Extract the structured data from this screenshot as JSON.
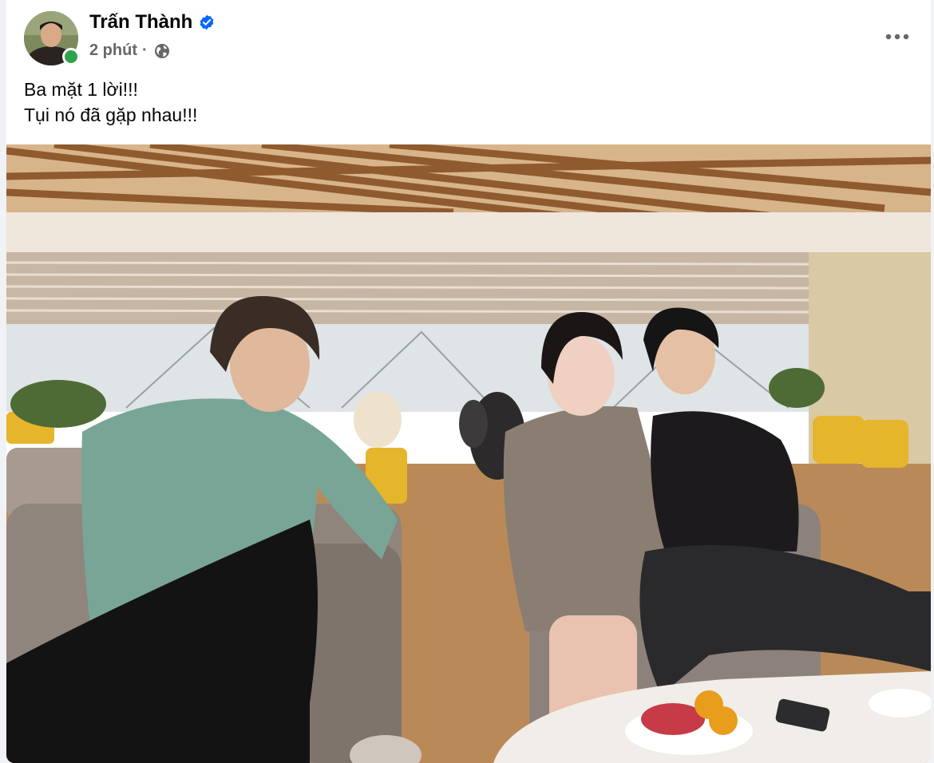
{
  "post": {
    "author": "Trấn Thành",
    "timestamp": "2 phút",
    "separator": "·",
    "audience_icon": "globe-icon",
    "verified_icon": "verified-badge-icon",
    "more_icon": "more-options-icon",
    "text_lines": [
      "Ba mặt 1 lời!!!",
      "Tụi nó đã gặp nhau!!!"
    ],
    "colors": {
      "verified": "#0866ff",
      "online": "#31a24c",
      "secondary_text": "#65676b"
    }
  }
}
